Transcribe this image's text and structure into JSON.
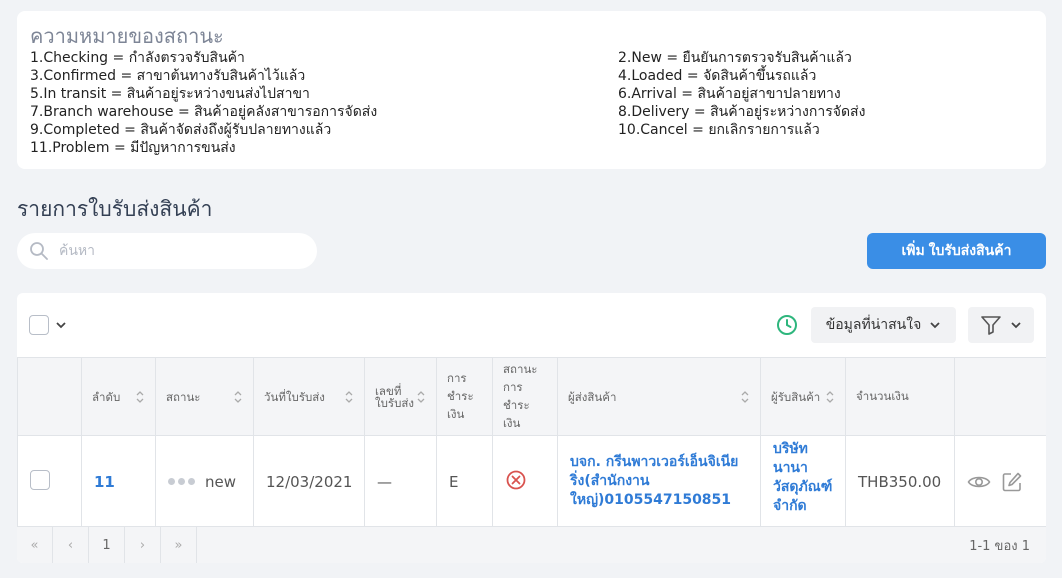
{
  "legend": {
    "title": "ความหมายของสถานะ",
    "items": [
      "1.Checking = กำลังตรวจรับสินค้า",
      "2.New = ยืนยันการตรวจรับสินค้าแล้ว",
      "3.Confirmed = สาขาต้นทางรับสินค้าไว้แล้ว",
      "4.Loaded = จัดสินค้าขึ้นรถแล้ว",
      "5.In transit = สินค้าอยู่ระหว่างขนส่งไปสาขา",
      "6.Arrival = สินค้าอยู่สาขาปลายทาง",
      "7.Branch warehouse = สินค้าอยู่คลังสาขารอการจัดส่ง",
      "8.Delivery = สินค้าอยู่ระหว่างการจัดส่ง",
      "9.Completed = สินค้าจัดส่งถึงผู้รับปลายทางแล้ว",
      "10.Cancel = ยกเลิกรายการแล้ว",
      "11.Problem = มีปัญหาการขนส่ง"
    ]
  },
  "section_title": "รายการใบรับส่งสินค้า",
  "search": {
    "placeholder": "ค้นหา"
  },
  "add_button": "เพิ่ม ใบรับส่งสินค้า",
  "toolbar": {
    "info_label": "ข้อมูลที่น่าสนใจ"
  },
  "table": {
    "headers": [
      "ลำดับ",
      "สถานะ",
      "วันที่ใบรับส่ง",
      "เลขที่ใบรับส่ง",
      "การชำระเงิน",
      "สถานะการชำระเงิน",
      "ผู้ส่งสินค้า",
      "ผู้รับสินค้า",
      "จำนวนเงิน"
    ],
    "rows": [
      {
        "seq": "11",
        "status": "new",
        "date": "12/03/2021",
        "doc_no": "—",
        "payment": "E",
        "sender": "บจก. กรีนพาวเวอร์เอ็นจิเนียริ่ง(สำนักงานใหญ่)0105547150851",
        "receiver": "บริษัทนานาวัสดุภัณฑ์ จำกัด",
        "amount": "THB350.00"
      }
    ]
  },
  "pagination": {
    "first": "«",
    "prev": "‹",
    "page": "1",
    "next": "›",
    "last": "»",
    "range": "1-1 ของ 1"
  },
  "colors": {
    "accent": "#3a8ee6",
    "link": "#2f7bd6",
    "clock": "#2eb67d",
    "error": "#d9534f"
  }
}
